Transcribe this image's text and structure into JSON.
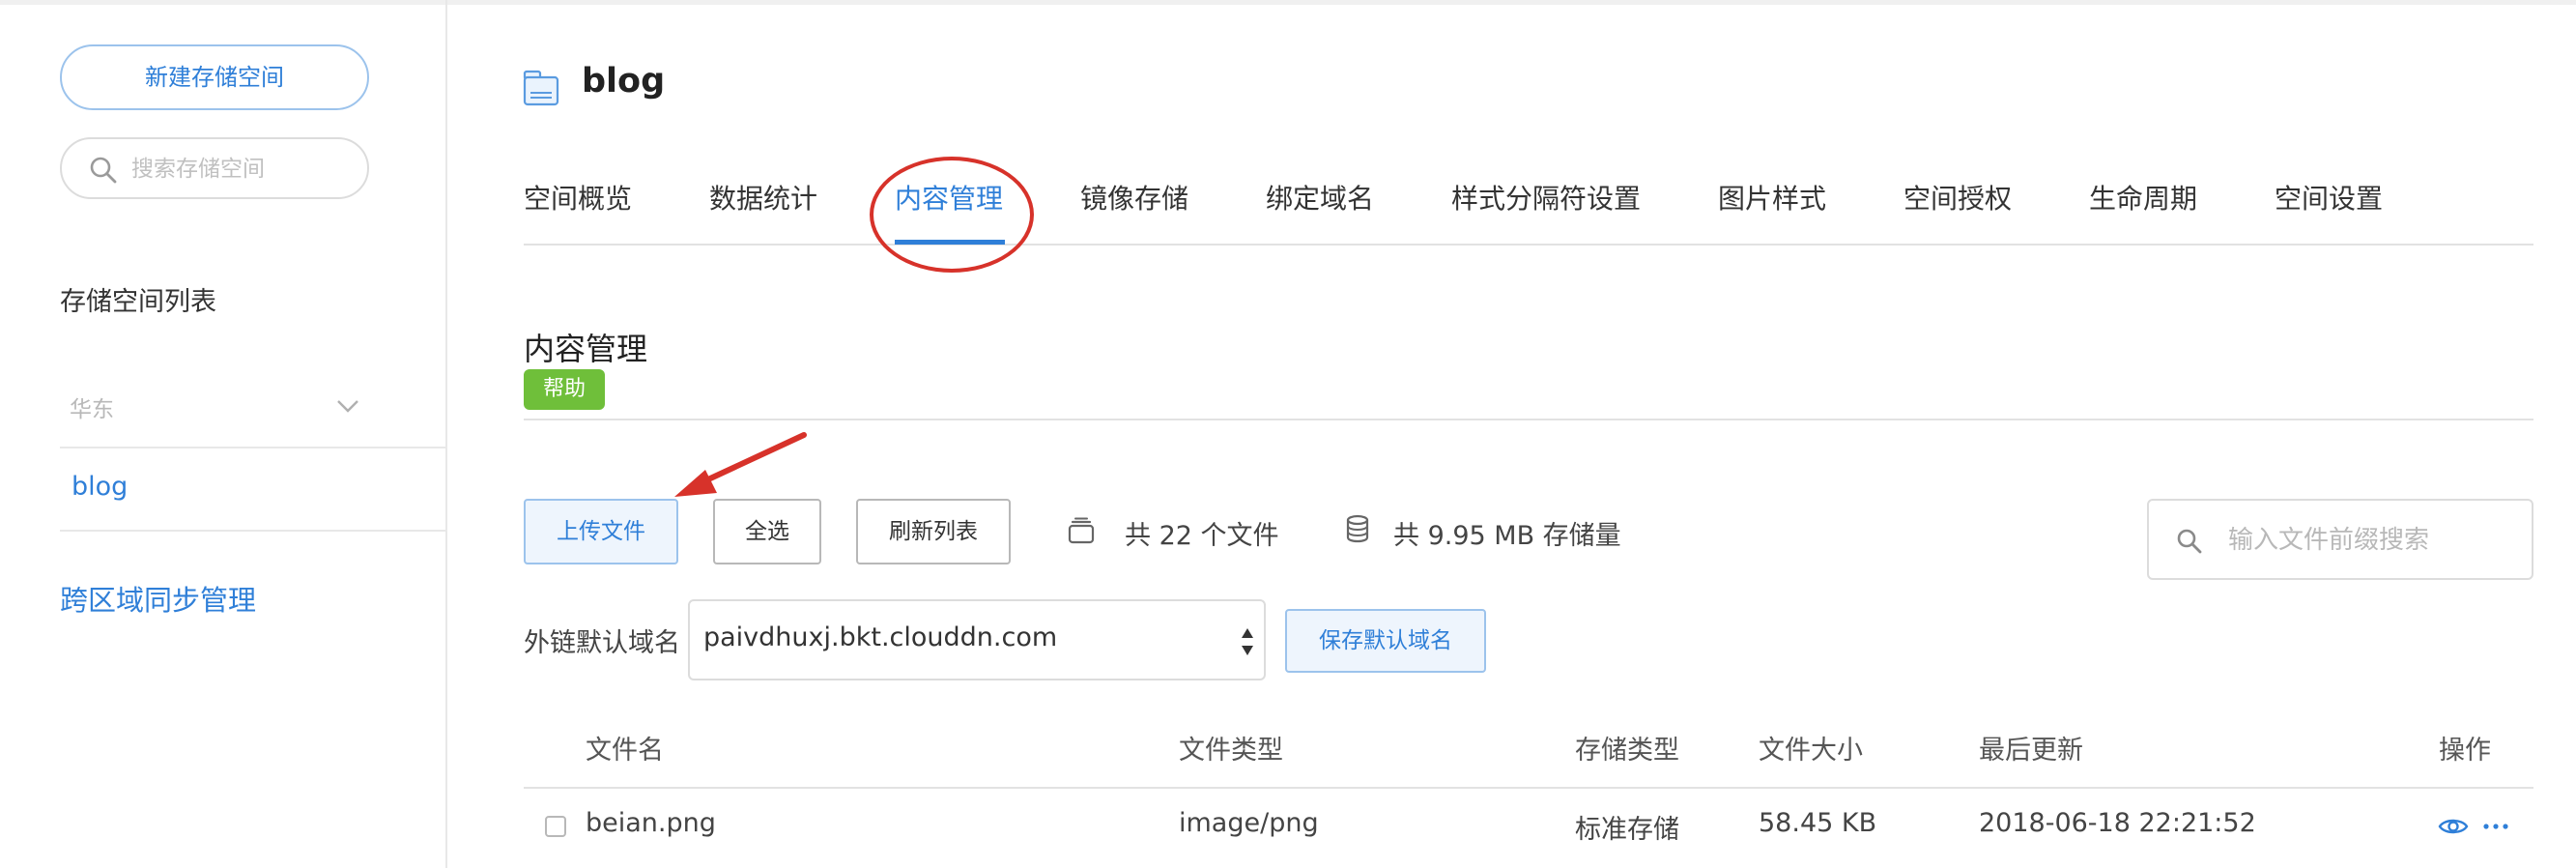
{
  "sidebar": {
    "new_bucket_label": "新建存储空间",
    "search_placeholder": "搜索存储空间",
    "bucket_list_title": "存储空间列表",
    "region_label": "华东",
    "bucket_name": "blog",
    "cross_region_link": "跨区域同步管理"
  },
  "header": {
    "bucket_title": "blog",
    "icon": "bucket-icon"
  },
  "tabs": [
    {
      "label": "空间概览",
      "active": false
    },
    {
      "label": "数据统计",
      "active": false
    },
    {
      "label": "内容管理",
      "active": true
    },
    {
      "label": "镜像存储",
      "active": false
    },
    {
      "label": "绑定域名",
      "active": false
    },
    {
      "label": "样式分隔符设置",
      "active": false
    },
    {
      "label": "图片样式",
      "active": false
    },
    {
      "label": "空间授权",
      "active": false
    },
    {
      "label": "生命周期",
      "active": false
    },
    {
      "label": "空间设置",
      "active": false
    }
  ],
  "content": {
    "section_title": "内容管理",
    "help_label": "帮助",
    "upload_label": "上传文件",
    "select_all_label": "全选",
    "refresh_label": "刷新列表",
    "file_count_text": "共 22 个文件",
    "storage_text": "共 9.95 MB 存储量",
    "file_search_placeholder": "输入文件前缀搜索",
    "domain_label": "外链默认域名",
    "domain_value": "paivdhuxj.bkt.clouddn.com",
    "save_domain_label": "保存默认域名"
  },
  "table": {
    "columns": [
      "文件名",
      "文件类型",
      "存储类型",
      "文件大小",
      "最后更新",
      "操作"
    ],
    "rows": [
      {
        "name": "beian.png",
        "type": "image/png",
        "storage": "标准存储",
        "size": "58.45 KB",
        "updated": "2018-06-18 22:21:52"
      }
    ]
  },
  "colors": {
    "accent": "#2f7fd8",
    "annotation": "#d7322a",
    "help_badge": "#6fbf3a"
  }
}
